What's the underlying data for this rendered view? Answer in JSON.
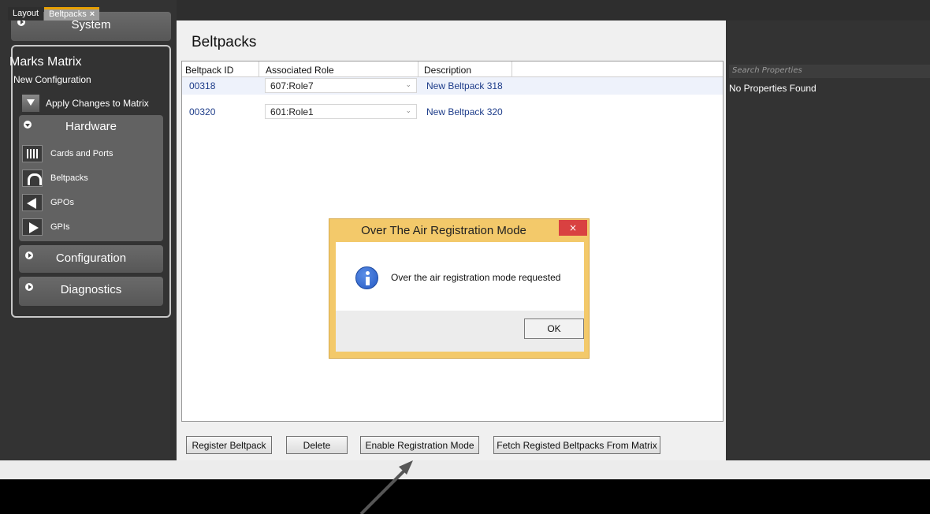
{
  "sidebar": {
    "system_label": "System",
    "matrix_title": "Marks Matrix",
    "matrix_subtitle": "New Configuration",
    "apply_label": "Apply Changes to Matrix",
    "hardware_label": "Hardware",
    "hardware_items": [
      {
        "label": "Cards and Ports",
        "icon": "cards-ports-icon"
      },
      {
        "label": "Beltpacks",
        "icon": "headset-icon"
      },
      {
        "label": "GPOs",
        "icon": "gpo-icon"
      },
      {
        "label": "GPIs",
        "icon": "gpi-icon"
      }
    ],
    "configuration_label": "Configuration",
    "diagnostics_label": "Diagnostics"
  },
  "tabs": [
    {
      "label": "Layout"
    },
    {
      "label": "Beltpacks",
      "close": "×"
    }
  ],
  "main": {
    "title": "Beltpacks",
    "columns": [
      "Beltpack ID",
      "Associated Role",
      "Description"
    ],
    "rows": [
      {
        "id": "00318",
        "role": "607:Role7",
        "description": "New Beltpack 318"
      },
      {
        "id": "00320",
        "role": "601:Role1",
        "description": "New Beltpack 320"
      }
    ],
    "buttons": {
      "register": "Register Beltpack",
      "delete": "Delete",
      "enable": "Enable Registration Mode",
      "fetch": "Fetch Registed Beltpacks From Matrix"
    }
  },
  "properties": {
    "search_placeholder": "Search Properties",
    "empty_text": "No Properties Found"
  },
  "dialog": {
    "title": "Over The Air Registration Mode",
    "close": "×",
    "message": "Over the air registration mode requested",
    "ok": "OK",
    "icon": "info-icon"
  },
  "colors": {
    "sidebar_bg": "#333333",
    "dialog_frame": "#f3c96a",
    "close_red": "#d94141",
    "link_blue": "#1e3d8a",
    "tab_accent": "#e8a000"
  }
}
